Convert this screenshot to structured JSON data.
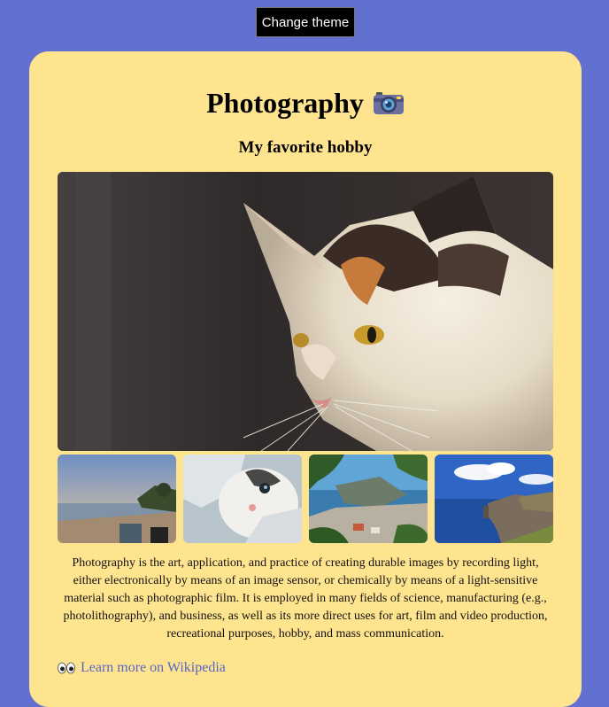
{
  "toolbar": {
    "theme_button_label": "Change theme"
  },
  "card": {
    "title": "Photography",
    "title_icon": "camera-icon",
    "subtitle": "My favorite hobby",
    "main_image": "calico-cat-photo",
    "thumbnails": [
      {
        "name": "beach-sunset-thumbnail"
      },
      {
        "name": "kitten-thumbnail"
      },
      {
        "name": "coastal-town-thumbnail"
      },
      {
        "name": "sea-cliffs-thumbnail"
      }
    ],
    "description": "Photography is the art, application, and practice of creating durable images by recording light, either electronically by means of an image sensor, or chemically by means of a light-sensitive material such as photographic film. It is employed in many fields of science, manufacturing (e.g., photolithography), and business, as well as its more direct uses for art, film and video production, recreational purposes, hobby, and mass communication.",
    "learn_more_icon": "eyes-icon",
    "learn_more_label": "Learn more on Wikipedia"
  },
  "colors": {
    "page_background": "#6271cf",
    "card_background": "#ffe48f",
    "link": "#5865c8",
    "button_background": "#000000"
  }
}
